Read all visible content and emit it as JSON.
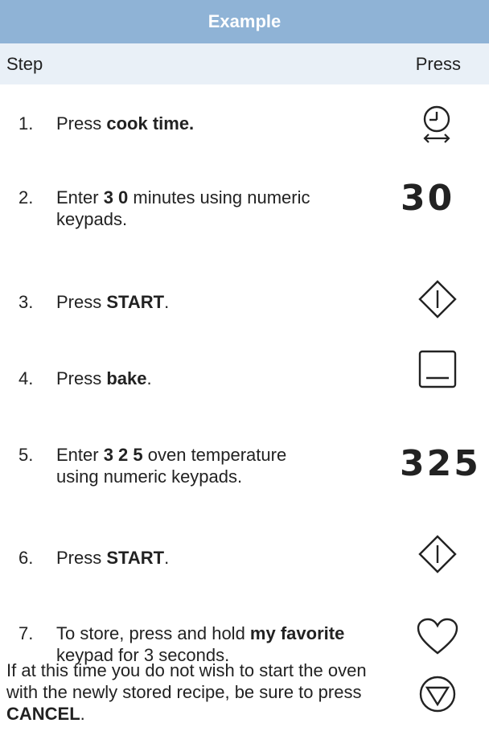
{
  "header": {
    "title": "Example"
  },
  "columns": {
    "step": "Step",
    "press": "Press"
  },
  "steps": [
    {
      "num": "1.",
      "parts": [
        {
          "t": "Press "
        },
        {
          "t": "cook time.",
          "b": true
        }
      ]
    },
    {
      "num": "2.",
      "parts": [
        {
          "t": "Enter "
        },
        {
          "t": "3 0",
          "b": true
        },
        {
          "t": " minutes using numeric keypads."
        }
      ]
    },
    {
      "num": "3.",
      "parts": [
        {
          "t": "Press "
        },
        {
          "t": "START",
          "b": true
        },
        {
          "t": "."
        }
      ]
    },
    {
      "num": "4.",
      "parts": [
        {
          "t": "Press "
        },
        {
          "t": "bake",
          "b": true
        },
        {
          "t": "."
        }
      ]
    },
    {
      "num": "5.",
      "parts": [
        {
          "t": "Enter "
        },
        {
          "t": "3 2 5",
          "b": true
        },
        {
          "t": " oven temperature using numeric keypads."
        }
      ]
    },
    {
      "num": "6.",
      "parts": [
        {
          "t": "Press "
        },
        {
          "t": "START",
          "b": true
        },
        {
          "t": "."
        }
      ]
    },
    {
      "num": "7.",
      "parts": [
        {
          "t": "To store, press and hold "
        },
        {
          "t": "my favorite",
          "b": true
        },
        {
          "t": " keypad for 3 seconds."
        }
      ]
    }
  ],
  "note": {
    "parts": [
      {
        "t": "If at this time you do not wish to start the oven with the newly stored recipe, be sure to press "
      },
      {
        "t": "CANCEL",
        "b": true
      },
      {
        "t": "."
      }
    ]
  },
  "keys": {
    "minutes": "30",
    "temperature": "325"
  },
  "icons": [
    "clock-arrows-icon",
    "start-icon",
    "bake-icon",
    "start-icon",
    "heart-icon",
    "cancel-icon"
  ],
  "colors": {
    "title_bg": "#8fb3d6",
    "header_bg": "#e9f0f7",
    "title_text": "#ffffff",
    "text": "#222222"
  }
}
